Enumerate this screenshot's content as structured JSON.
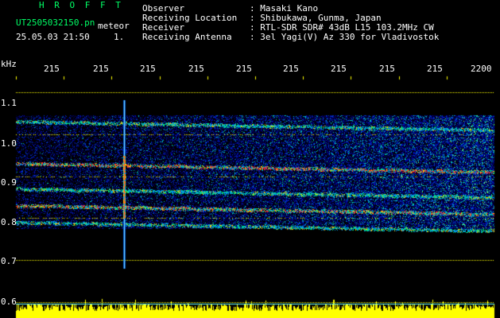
{
  "header": {
    "app_title": "H R O F F T",
    "filename": "UT2505032150.pn",
    "mode_label": "meteor",
    "datetime": "25.05.03 21:50",
    "index": "1.",
    "info_rows": [
      {
        "label": "Observer",
        "value": ": Masaki Kano"
      },
      {
        "label": "Receiving Location",
        "value": ": Shibukawa, Gunma, Japan"
      },
      {
        "label": "Receiver",
        "value": ": RTL-SDR SDR# 43dB L15 103.2MHz CW"
      },
      {
        "label": "Receiving Antenna",
        "value": ": 3el Yagi(V) Az 330 for Vladivostok"
      }
    ]
  },
  "axes": {
    "y_unit": "kHz",
    "y_ticks": [
      "1.1",
      "1.0",
      "0.9",
      "0.8",
      "0.7",
      "0.6"
    ],
    "x_ticks": [
      "215",
      "215",
      "215",
      "215",
      "215",
      "215",
      "215",
      "215",
      "215",
      "2200"
    ]
  },
  "colors": {
    "background": "#000000",
    "header_white": "#ffffff",
    "header_green": "#00ff66",
    "grid": "#ffff00",
    "waterfall_base": "#00007a",
    "signal_red": "#ff2020",
    "meteor": "#ff3030",
    "level_fill": "#ffff00",
    "level_line": "#66ffff"
  },
  "chart_data": {
    "type": "heatmap",
    "y_range_khz": [
      0.6,
      1.15
    ],
    "signal_bands_khz": [
      1.03,
      0.93,
      0.87,
      0.83,
      0.79
    ],
    "meteor_trail": {
      "x_position_fraction": 0.2,
      "y_range_khz": [
        0.68,
        1.08
      ]
    },
    "level_bar_threshold_fraction": 0.15
  }
}
